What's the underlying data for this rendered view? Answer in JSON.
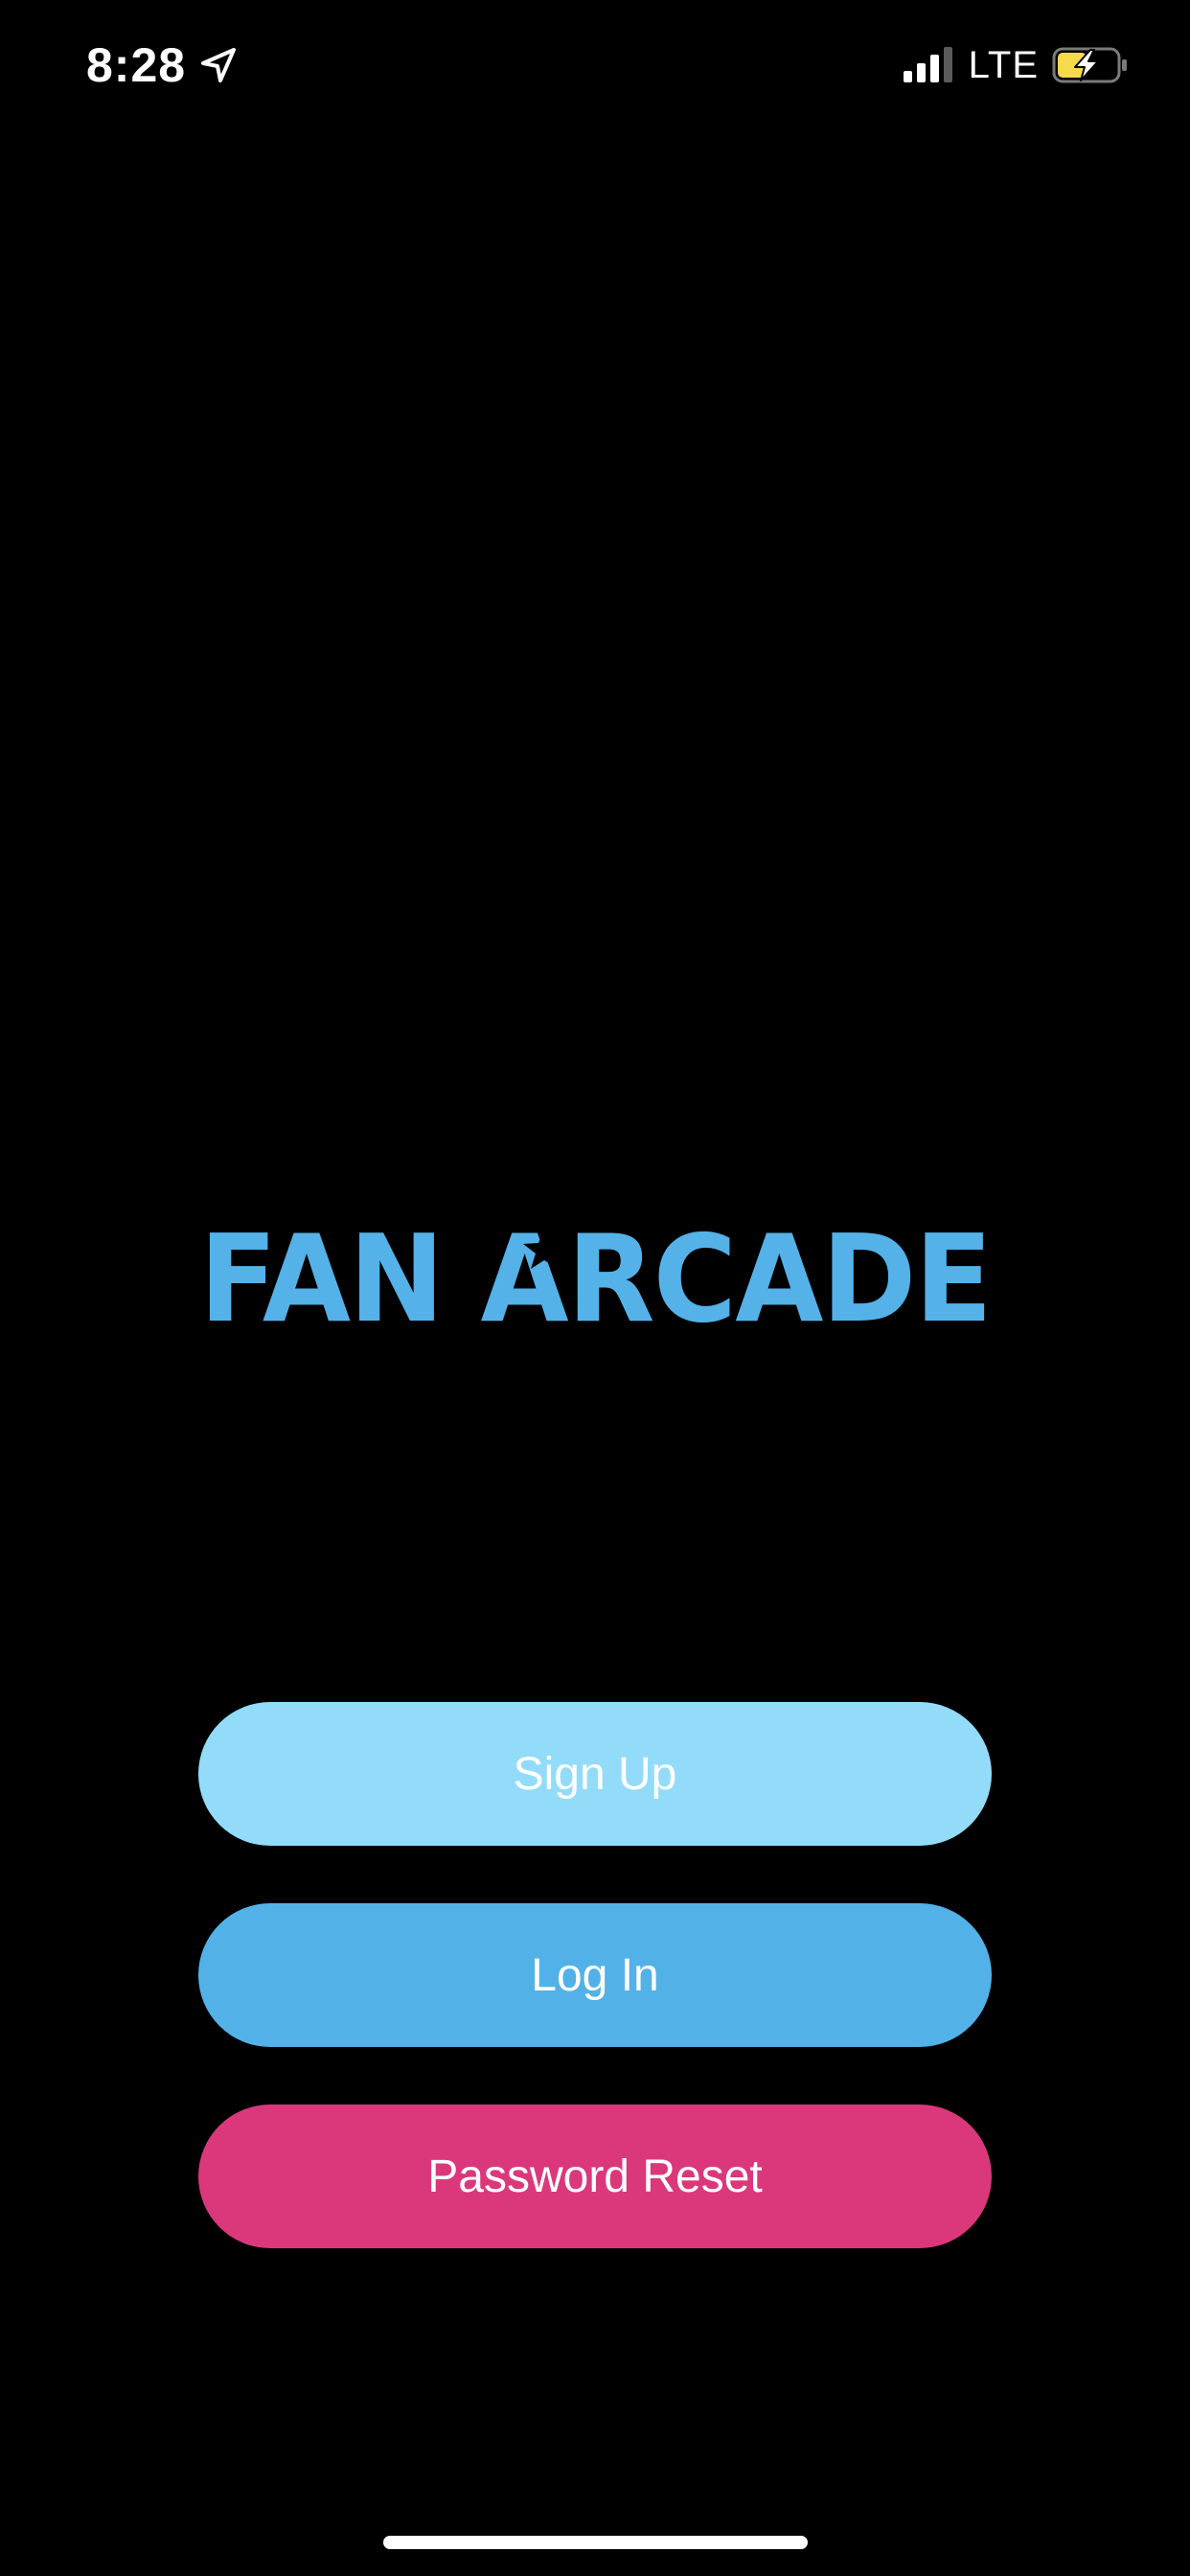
{
  "status_bar": {
    "time": "8:28",
    "network": "LTE",
    "signal_bars_active": 3,
    "signal_bars_total": 4,
    "battery_level": 0.5,
    "battery_charging": true,
    "icons": {
      "location": "location-arrow-icon",
      "signal": "cellular-signal-icon",
      "battery": "battery-charging-icon"
    }
  },
  "logo": {
    "text": "FAN ARCADE",
    "color": "#54b2e8"
  },
  "buttons": {
    "sign_up": {
      "label": "Sign Up",
      "color": "#92dcfa"
    },
    "log_in": {
      "label": "Log In",
      "color": "#52b2e8"
    },
    "password_reset": {
      "label": "Password Reset",
      "color": "#db387c"
    }
  },
  "colors": {
    "background": "#000000",
    "battery_fill": "#f7d94c"
  }
}
